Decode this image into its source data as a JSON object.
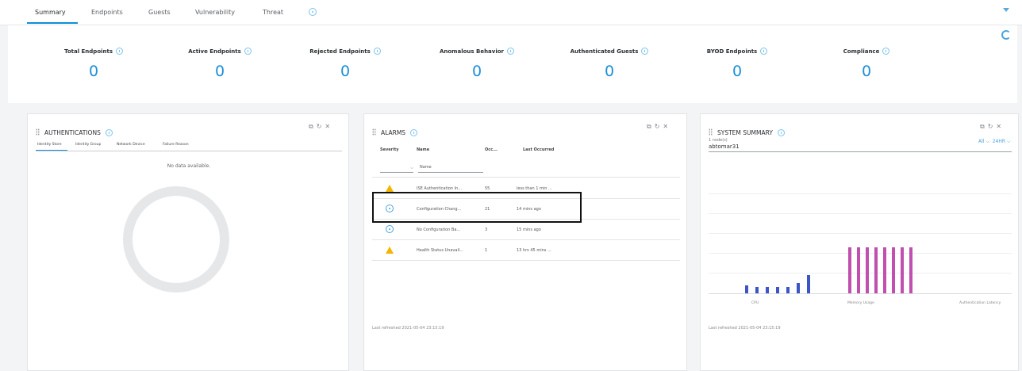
{
  "tabs": [
    {
      "label": "Summary",
      "active": true
    },
    {
      "label": "Endpoints",
      "active": false
    },
    {
      "label": "Guests",
      "active": false
    },
    {
      "label": "Vulnerability",
      "active": false
    },
    {
      "label": "Threat",
      "active": false
    }
  ],
  "metrics": [
    {
      "label": "Total Endpoints",
      "value": "0"
    },
    {
      "label": "Active Endpoints",
      "value": "0"
    },
    {
      "label": "Rejected Endpoints",
      "value": "0"
    },
    {
      "label": "Anomalous Behavior",
      "value": "0"
    },
    {
      "label": "Authenticated Guests",
      "value": "0"
    },
    {
      "label": "BYOD Endpoints",
      "value": "0"
    },
    {
      "label": "Compliance",
      "value": "0"
    }
  ],
  "authentications": {
    "title": "AUTHENTICATIONS",
    "tabs": [
      "Identity Store",
      "Identity Group",
      "Network Device",
      "Failure Reason"
    ],
    "empty_text": "No data available."
  },
  "alarms": {
    "title": "ALARMS",
    "columns": [
      "Severity",
      "Name",
      "Occ...",
      "Last Occurred"
    ],
    "name_filter_placeholder": "Name",
    "rows": [
      {
        "severity": "warning",
        "name": "ISE Authentication In...",
        "occurrences": "55",
        "last": "less than 1 min ..."
      },
      {
        "severity": "info",
        "name": "Configuration Chang...",
        "occurrences": "21",
        "last": "14 mins ago"
      },
      {
        "severity": "info",
        "name": "No Configuration Ba...",
        "occurrences": "3",
        "last": "15 mins ago"
      },
      {
        "severity": "warning",
        "name": "Health Status Unavail...",
        "occurrences": "1",
        "last": "13 hrs 45 mins ..."
      }
    ],
    "last_refreshed": "Last refreshed 2021-05-04 23:15:19"
  },
  "system_summary": {
    "title": "SYSTEM SUMMARY",
    "node_count": "1 node(s)",
    "hostname": "abtomar31",
    "filter_scope": "All",
    "filter_range": "24HR",
    "categories": [
      "CPU",
      "Memory Usage",
      "Authentication Latency"
    ],
    "cpu_values": [
      18,
      14,
      14,
      14,
      14,
      22,
      40
    ],
    "memory_values": [
      100,
      100,
      100,
      100,
      100,
      100,
      100,
      100
    ],
    "last_refreshed": "Last refreshed 2021-05-04 23:15:19"
  },
  "colors": {
    "accent": "#1d8fd6",
    "cpu_bar": "#3b55c4",
    "memory_bar": "#c04fb0",
    "warning": "#f5b400"
  }
}
